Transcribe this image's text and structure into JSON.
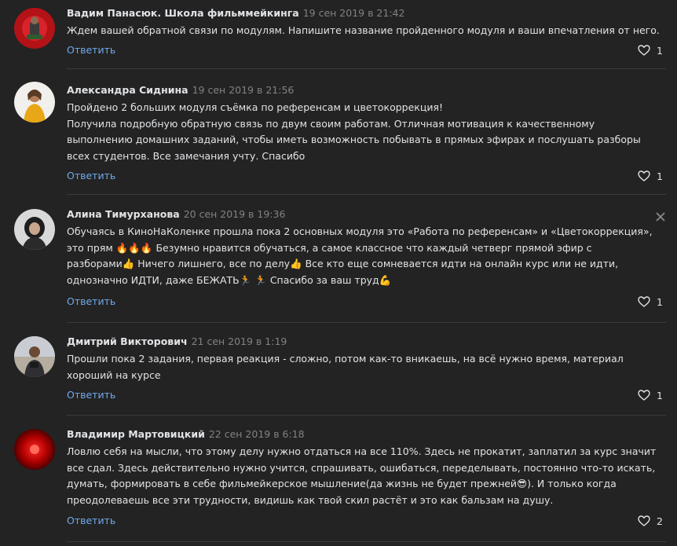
{
  "reply_label": "Ответить",
  "comments": [
    {
      "author": "Вадим Панасюк. Школа фильммейкинга",
      "date": "19 сен 2019 в 21:42",
      "text": "Ждем вашей обратной связи по модулям. Напишите название пройденного модуля и ваши впечатления от него.",
      "likes": "1"
    },
    {
      "author": "Александра Сиднина",
      "date": "19 сен 2019 в 21:56",
      "text": "Пройдено 2 больших модуля съёмка по референсам и цветокоррекция!\nПолучила подробную обратную связь по двум своим работам. Отличная мотивация к качественному\nвыполнению домашних заданий, чтобы иметь возможность побывать в прямых эфирах и послушать разборы\nвсех студентов. Все замечания учту. Спасибо",
      "likes": "1"
    },
    {
      "author": "Алина Тимурханова",
      "date": "20 сен 2019 в 19:36",
      "text": "Обучаясь в КиноНаКоленке прошла пока 2 основных модуля это «Работа по референсам» и «Цветокоррекция»,\nэто прям 🔥🔥🔥 Безумно нравится обучаться, а самое классное что каждый четверг прямой эфир с\nразборами👍 Ничего лишнего, все по делу👍 Все кто еще сомневается идти на онлайн курс или не идти,\nоднозначно ИДТИ, даже БЕЖАТЬ🏃 🏃 Спасибо за ваш труд💪",
      "likes": "1"
    },
    {
      "author": "Дмитрий Викторович",
      "date": "21 сен 2019 в 1:19",
      "text": "Прошли пока 2 задания, первая реакция - сложно, потом как-то вникаешь, на всё нужно время, материал\nхороший на курсе",
      "likes": "1"
    },
    {
      "author": "Владимир Мартовицкий",
      "date": "22 сен 2019 в 6:18",
      "text": "Ловлю себя на мысли, что этому делу нужно отдаться на все 110%. Здесь не прокатит, заплатил за курс значит\nвсе сдал. Здесь действительно нужно учится, спрашивать, ошибаться, переделывать, постоянно что-то искать,\nдумать, формировать в себе фильмейкерское мышление(да жизнь не будет прежней😎). И только когда\nпреодолеваешь все эти трудности, видишь как твой скил растёт и это как бальзам на душу.",
      "likes": "2"
    }
  ],
  "colors": {
    "background": "#232323",
    "link": "#71aaeb",
    "date": "#828282",
    "text": "#e1e3e6"
  },
  "icons": {
    "like": "heart-outline-icon",
    "close": "close-x-icon"
  }
}
